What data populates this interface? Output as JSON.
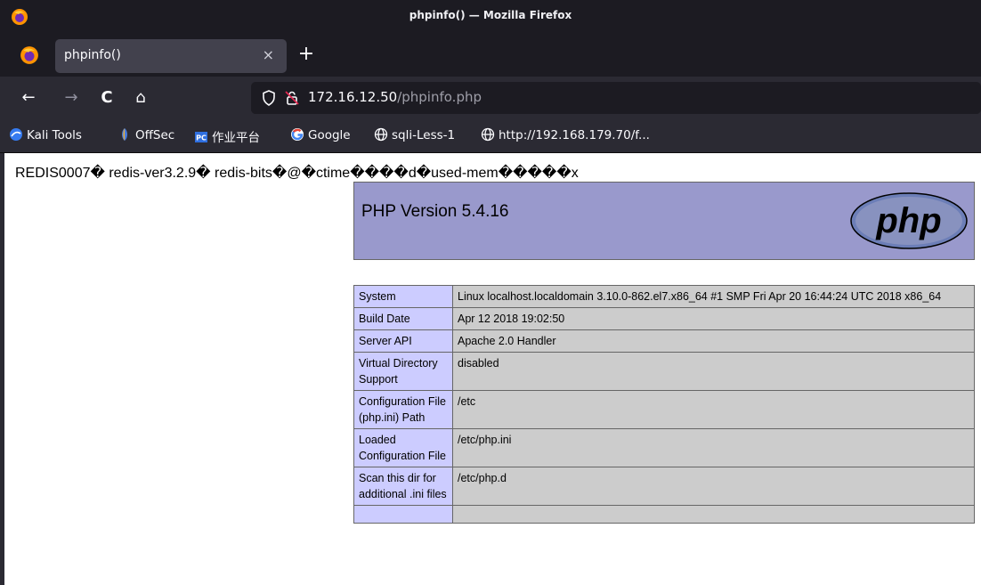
{
  "window": {
    "title": "phpinfo() — Mozilla Firefox"
  },
  "tabs": [
    {
      "label": "phpinfo()",
      "close": "×"
    }
  ],
  "new_tab_label": "+",
  "nav": {
    "back": "←",
    "forward": "→",
    "reload": "C",
    "home": "⌂"
  },
  "url": {
    "host": "172.16.12.50",
    "path": "/phpinfo.php"
  },
  "bookmarks": [
    {
      "label": "Kali Tools",
      "icon": "kali-icon"
    },
    {
      "label": "OffSec",
      "icon": "offsec-icon"
    },
    {
      "label": "作业平台",
      "icon": "pc-icon"
    },
    {
      "label": "Google",
      "icon": "google-icon"
    },
    {
      "label": "sqli-Less-1",
      "icon": "globe-icon"
    },
    {
      "label": "http://192.168.179.70/f...",
      "icon": "globe-icon"
    }
  ],
  "page": {
    "redis_line": "REDIS0007� redis-ver3.2.9� redis-bits�@�ctime����d�used-mem�����x",
    "php_version": "PHP Version 5.4.16",
    "php_logo_text": "php",
    "rows": [
      {
        "key": "System",
        "value": "Linux localhost.localdomain 3.10.0-862.el7.x86_64 #1 SMP Fri Apr 20 16:44:24 UTC 2018 x86_64"
      },
      {
        "key": "Build Date",
        "value": "Apr 12 2018 19:02:50"
      },
      {
        "key": "Server API",
        "value": "Apache 2.0 Handler"
      },
      {
        "key": "Virtual Directory Support",
        "value": "disabled"
      },
      {
        "key": "Configuration File (php.ini) Path",
        "value": "/etc"
      },
      {
        "key": "Loaded Configuration File",
        "value": "/etc/php.ini"
      },
      {
        "key": "Scan this dir for additional .ini files",
        "value": "/etc/php.d"
      },
      {
        "key": "",
        "value": ""
      }
    ]
  },
  "colors": {
    "chrome_dark": "#1c1b22",
    "toolbar": "#2b2a33",
    "php_header": "#9999cc",
    "php_key": "#ccccff",
    "php_value": "#cccccc"
  }
}
